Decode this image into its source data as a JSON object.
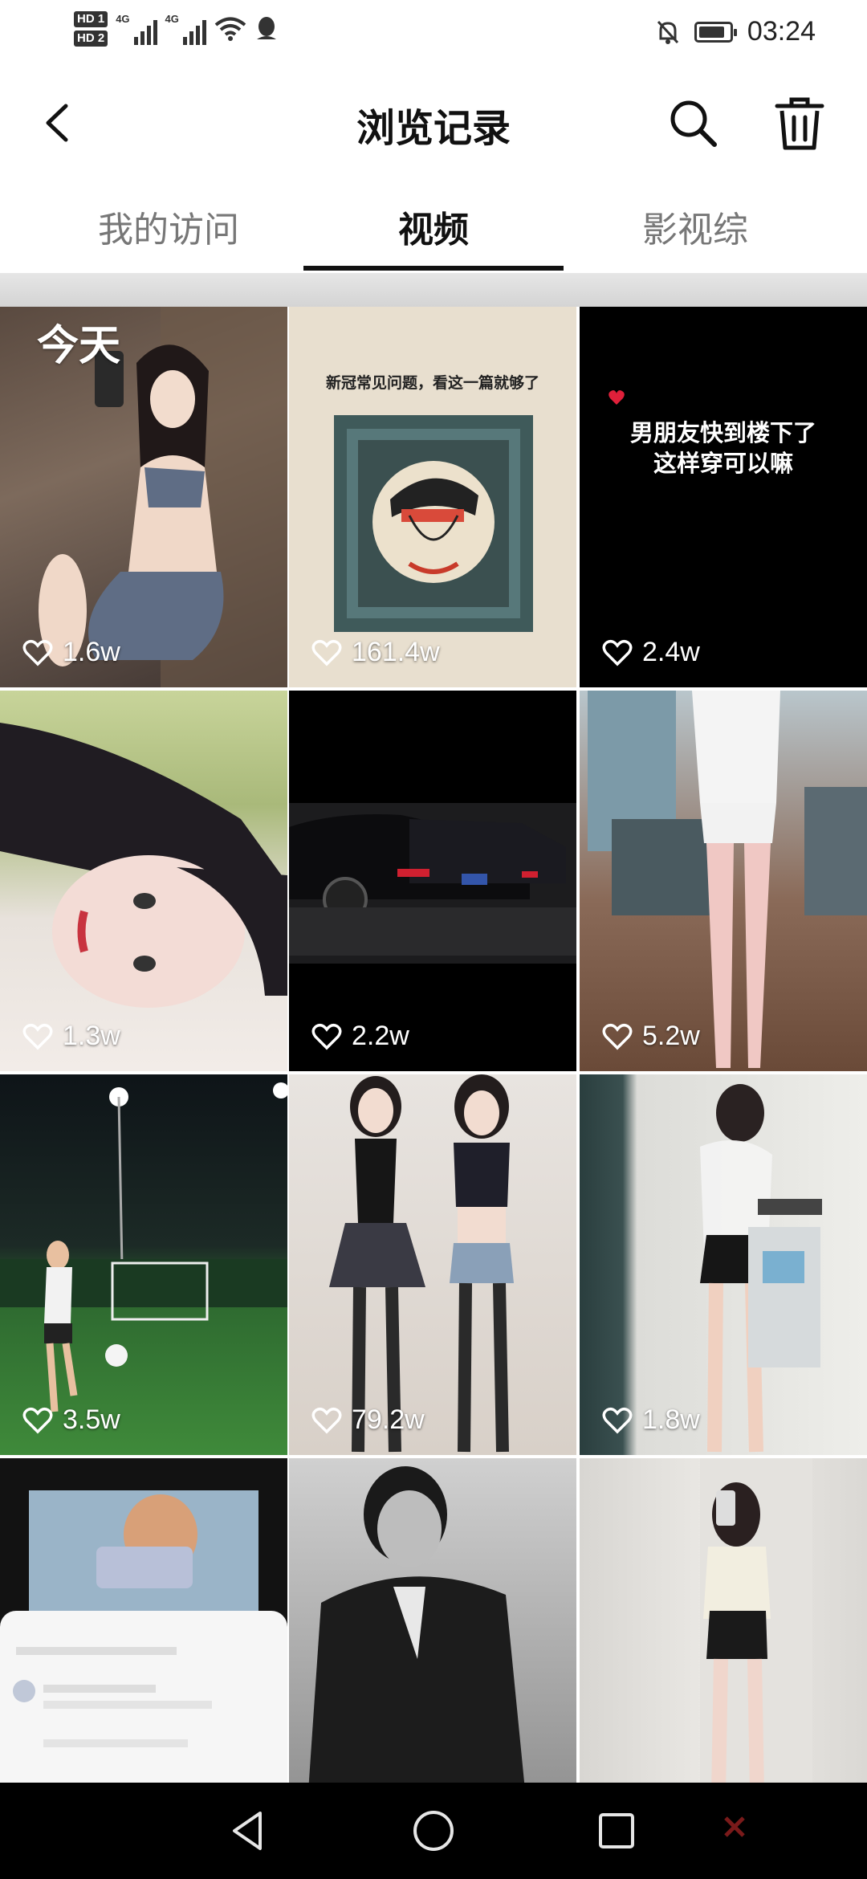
{
  "status_bar": {
    "hd1": "HD 1",
    "hd2": "HD 2",
    "signal1_label": "4G",
    "signal2_label": "4G",
    "time": "03:24",
    "battery_level": 0.85
  },
  "header": {
    "title": "浏览记录",
    "back_icon": "chevron-left-icon",
    "search_icon": "search-icon",
    "delete_icon": "trash-icon"
  },
  "tabs": [
    {
      "label": "我的访问",
      "active": false
    },
    {
      "label": "视频",
      "active": true
    },
    {
      "label": "影视综",
      "active": false
    }
  ],
  "grid": {
    "section_label": "今天",
    "items": [
      {
        "likes": "1.6w"
      },
      {
        "likes": "161.4w",
        "caption": "新冠常见问题，看这一篇就够了"
      },
      {
        "likes": "2.4w",
        "caption_line1": "男朋友快到楼下了",
        "caption_line2": "这样穿可以嘛"
      },
      {
        "likes": "1.3w"
      },
      {
        "likes": "2.2w"
      },
      {
        "likes": "5.2w"
      },
      {
        "likes": "3.5w"
      },
      {
        "likes": "79.2w"
      },
      {
        "likes": "1.8w"
      },
      {
        "likes": ""
      },
      {
        "likes": ""
      },
      {
        "likes": ""
      }
    ]
  },
  "nav_bar": {
    "back_icon": "triangle-back-icon",
    "home_icon": "circle-home-icon",
    "recent_icon": "square-recent-icon"
  },
  "colors": {
    "background": "#ffffff",
    "text_primary": "#111111",
    "text_secondary": "#777777",
    "nav_bar": "#000000"
  }
}
